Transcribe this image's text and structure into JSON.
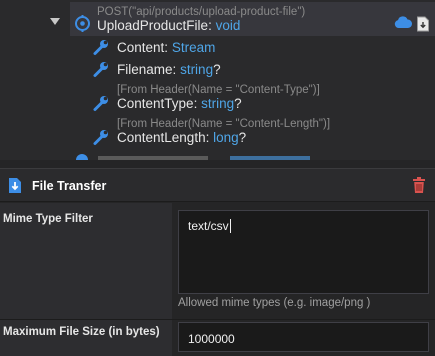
{
  "tree": {
    "operation": {
      "annotation": "POST(\"api/products/upload-product-file\")",
      "name": "UploadProductFile",
      "colon": ":",
      "return_type": "void"
    },
    "params": [
      {
        "name": "Content",
        "type": "Stream",
        "nullable": "",
        "annotation": ""
      },
      {
        "name": "Filename",
        "type": "string",
        "nullable": "?",
        "annotation": ""
      },
      {
        "name": "ContentType",
        "type": "string",
        "nullable": "?",
        "annotation": "[From Header(Name = \"Content-Type\")]"
      },
      {
        "name": "ContentLength",
        "type": "long",
        "nullable": "?",
        "annotation": "[From Header(Name = \"Content-Length\")]"
      }
    ],
    "icons": {
      "operation": "operation-icon",
      "param": "wrench-icon",
      "cloud": "cloud-icon",
      "document": "document-icon"
    },
    "colors": {
      "type": "#4fa6e8",
      "accent_icon": "#3d8ee6"
    }
  },
  "properties": {
    "title": "File Transfer",
    "mime_filter": {
      "label": "Mime Type Filter",
      "value": "text/csv",
      "help": "Allowed mime types (e.g. image/png )"
    },
    "max_size": {
      "label": "Maximum File Size (in bytes)",
      "value": "1000000"
    },
    "icons": {
      "header": "file-transfer-icon",
      "delete": "trash-icon"
    },
    "colors": {
      "delete": "#d9534f"
    }
  }
}
